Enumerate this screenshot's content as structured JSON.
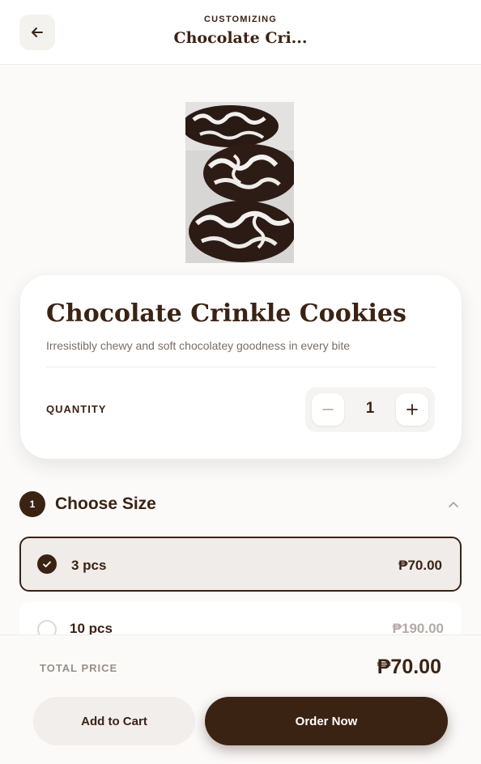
{
  "header": {
    "eyebrow": "CUSTOMIZING",
    "title": "Chocolate Cri..."
  },
  "product": {
    "name": "Chocolate Crinkle Cookies",
    "description": "Irresistibly chewy and soft chocolatey goodness in every bite"
  },
  "quantity": {
    "label": "QUANTITY",
    "value": "1"
  },
  "size_section": {
    "number": "1",
    "title": "Choose Size",
    "options": [
      {
        "label": "3 pcs",
        "price": "₱70.00",
        "selected": true
      },
      {
        "label": "10 pcs",
        "price": "₱190.00",
        "selected": false
      }
    ]
  },
  "footer": {
    "total_label": "TOTAL PRICE",
    "total_value": "₱70.00",
    "add_to_cart": "Add to Cart",
    "order_now": "Order Now"
  },
  "colors": {
    "brand": "#3b2314",
    "background": "#fbfaf9",
    "muted": "#9a8f88"
  },
  "icons": [
    "arrow-left-icon",
    "minus-icon",
    "plus-icon",
    "chevron-up-icon",
    "check-icon"
  ]
}
